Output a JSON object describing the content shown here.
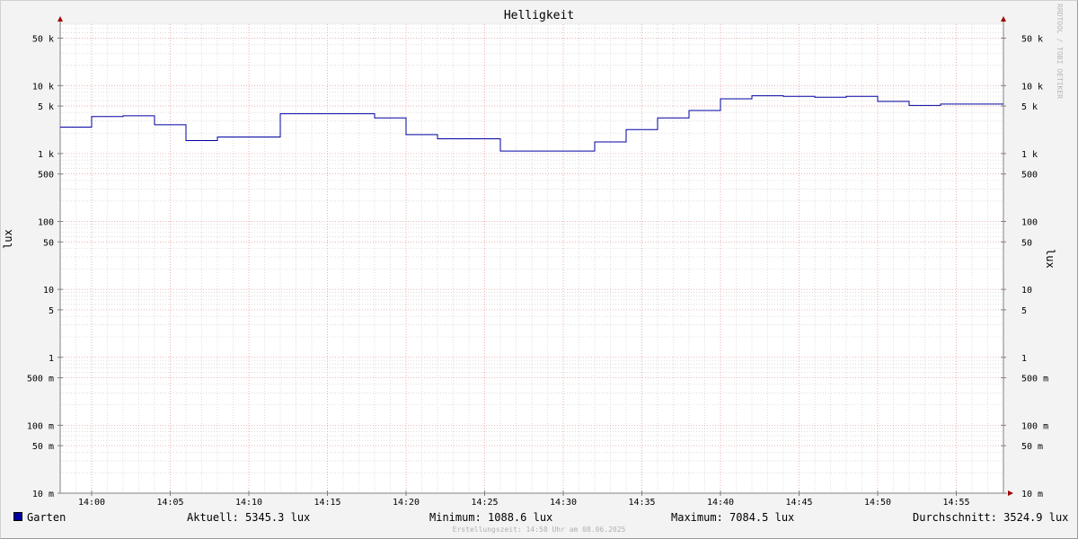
{
  "chart_data": {
    "type": "line",
    "title": "Helligkeit",
    "ylabel": "lux",
    "ylabel_right": "lux",
    "y_scale": "log",
    "ylim": [
      0.01,
      80000
    ],
    "x_range": [
      "13:58",
      "14:58"
    ],
    "x_ticks": [
      "14:00",
      "14:05",
      "14:10",
      "14:15",
      "14:20",
      "14:25",
      "14:30",
      "14:35",
      "14:40",
      "14:45",
      "14:50",
      "14:55"
    ],
    "y_ticks": [
      {
        "value": 50000,
        "label": "50 k"
      },
      {
        "value": 10000,
        "label": "10 k"
      },
      {
        "value": 5000,
        "label": "5 k"
      },
      {
        "value": 1000,
        "label": "1 k"
      },
      {
        "value": 500,
        "label": "500"
      },
      {
        "value": 100,
        "label": "100"
      },
      {
        "value": 50,
        "label": "50"
      },
      {
        "value": 10,
        "label": "10"
      },
      {
        "value": 5,
        "label": "5"
      },
      {
        "value": 1,
        "label": "1"
      },
      {
        "value": 0.5,
        "label": "500 m"
      },
      {
        "value": 0.1,
        "label": "100 m"
      },
      {
        "value": 0.05,
        "label": "50 m"
      },
      {
        "value": 0.01,
        "label": "10 m"
      }
    ],
    "grid": true,
    "series": [
      {
        "name": "Garten",
        "color": "#0000a0",
        "step": true,
        "points": [
          {
            "x": "13:58",
            "y": 2450
          },
          {
            "x": "14:00",
            "y": 3500
          },
          {
            "x": "14:02",
            "y": 3600
          },
          {
            "x": "14:04",
            "y": 2650
          },
          {
            "x": "14:06",
            "y": 1550
          },
          {
            "x": "14:08",
            "y": 1750
          },
          {
            "x": "14:12",
            "y": 3850
          },
          {
            "x": "14:18",
            "y": 3350
          },
          {
            "x": "14:20",
            "y": 1900
          },
          {
            "x": "14:22",
            "y": 1650
          },
          {
            "x": "14:26",
            "y": 1090
          },
          {
            "x": "14:32",
            "y": 1480
          },
          {
            "x": "14:34",
            "y": 2250
          },
          {
            "x": "14:36",
            "y": 3350
          },
          {
            "x": "14:38",
            "y": 4300
          },
          {
            "x": "14:40",
            "y": 6400
          },
          {
            "x": "14:42",
            "y": 7080
          },
          {
            "x": "14:44",
            "y": 6950
          },
          {
            "x": "14:46",
            "y": 6750
          },
          {
            "x": "14:48",
            "y": 6950
          },
          {
            "x": "14:50",
            "y": 5850
          },
          {
            "x": "14:52",
            "y": 5100
          },
          {
            "x": "14:54",
            "y": 5345
          }
        ]
      }
    ]
  },
  "legend": {
    "series_name": "Garten",
    "current": "Aktuell: 5345.3 lux",
    "minimum": "Minimum: 1088.6 lux",
    "maximum": "Maximum: 7084.5 lux",
    "average": "Durchschnitt: 3524.9 lux"
  },
  "watermark": "RRDTOOL / TOBI OETIKER",
  "footer": "Erstellungszeit: 14:58 Uhr am 08.06.2025",
  "colors": {
    "background": "#f3f3f3",
    "plot_background": "#ffffff",
    "major_grid": "#e8a0a0",
    "minor_grid": "#c8c8c8",
    "axis": "#808080",
    "arrow": "#a00000",
    "line": "#0000a0"
  }
}
